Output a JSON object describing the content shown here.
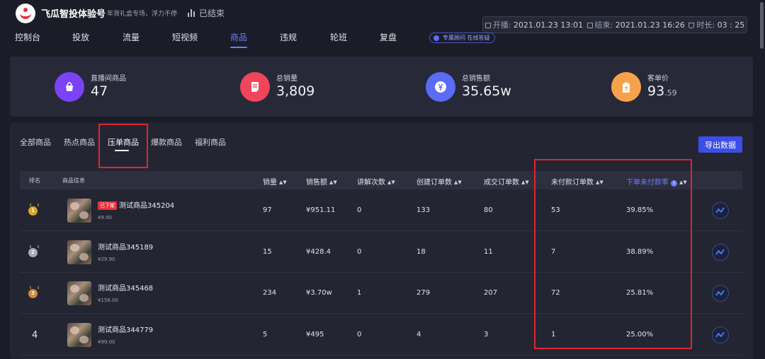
{
  "header": {
    "brand": "飞瓜智投体验号",
    "slogan": "年货礼盒专场，浮力不停",
    "status": "已结束",
    "start_label": "开播:",
    "start_time": "2021.01.23 13:01",
    "end_label": "结束:",
    "end_time": "2021.01.23 16:26",
    "duration_label": "时长:",
    "duration": "03 : 25",
    "consultant": "专属顾问 在线答疑"
  },
  "nav": [
    {
      "label": "控制台"
    },
    {
      "label": "投放"
    },
    {
      "label": "流量"
    },
    {
      "label": "短视频"
    },
    {
      "label": "商品"
    },
    {
      "label": "违规"
    },
    {
      "label": "轮班"
    },
    {
      "label": "复盘"
    }
  ],
  "stats": [
    {
      "label": "直播间商品",
      "value": "47",
      "decimal": "",
      "color": "#7b42f6",
      "icon": "shopping-bag-icon"
    },
    {
      "label": "总销量",
      "value": "3,809",
      "decimal": "",
      "color": "#f0455a",
      "icon": "document-icon"
    },
    {
      "label": "总销售额",
      "value": "35.65w",
      "decimal": "",
      "color": "#5a6cf5",
      "icon": "yen-coin-icon"
    },
    {
      "label": "客单价",
      "value": "93",
      "decimal": ".59",
      "color": "#f7a24b",
      "icon": "price-tag-icon"
    }
  ],
  "subtabs": [
    {
      "label": "全部商品"
    },
    {
      "label": "热点商品"
    },
    {
      "label": "压单商品"
    },
    {
      "label": "爆款商品"
    },
    {
      "label": "福利商品"
    }
  ],
  "export_label": "导出数据",
  "columns": {
    "rank": "排名",
    "info": "商品信息",
    "sales": "销量",
    "revenue": "销售额",
    "explains": "讲解次数",
    "created": "创建订单数",
    "completed": "成交订单数",
    "unpaid": "未付款订单数",
    "unpaid_rate": "下单未付款率"
  },
  "rows": [
    {
      "rank": "1",
      "badge": "已下架",
      "name": "测试商品345204",
      "price": "¥9.90",
      "sales": "97",
      "revenue": "¥951.11",
      "explains": "0",
      "created": "133",
      "completed": "80",
      "unpaid": "53",
      "rate": "39.85%",
      "medal": "#d9a72a"
    },
    {
      "rank": "2",
      "badge": "",
      "name": "测试商品345189",
      "price": "¥29.90",
      "sales": "15",
      "revenue": "¥428.4",
      "explains": "0",
      "created": "18",
      "completed": "11",
      "unpaid": "7",
      "rate": "38.89%",
      "medal": "#a7abb6"
    },
    {
      "rank": "3",
      "badge": "",
      "name": "测试商品345468",
      "price": "¥158.00",
      "sales": "234",
      "revenue": "¥3.70w",
      "explains": "1",
      "created": "279",
      "completed": "207",
      "unpaid": "72",
      "rate": "25.81%",
      "medal": "#cf8a3e"
    },
    {
      "rank": "4",
      "badge": "",
      "name": "测试商品344779",
      "price": "¥99.00",
      "sales": "5",
      "revenue": "¥495",
      "explains": "0",
      "created": "4",
      "completed": "3",
      "unpaid": "1",
      "rate": "25.00%",
      "medal": ""
    }
  ]
}
